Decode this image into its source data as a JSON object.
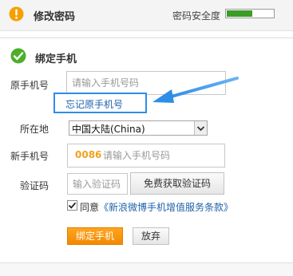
{
  "header": {
    "title": "修改密码",
    "security_label": "密码安全度",
    "security_level": 0.55,
    "security_color": "#3d9b28"
  },
  "section": {
    "title": "绑定手机"
  },
  "form": {
    "old_phone_label": "原手机号",
    "old_phone_placeholder": "请输入手机号码",
    "forgot_link": "忘记原手机号",
    "location_label": "所在地",
    "location_value": "中国大陆(China)",
    "new_phone_label": "新手机号",
    "country_code": "0086",
    "new_phone_placeholder": "请输入手机号码",
    "code_label": "验证码",
    "code_placeholder": "输入验证码",
    "get_code_button": "免费获取验证码",
    "agree_prefix": "同意",
    "agree_link": "《新浪微博手机增值服务条款》",
    "agree_checked": true,
    "bind_button": "绑定手机",
    "cancel_button": "放弃"
  },
  "colors": {
    "accent_orange": "#f28900",
    "link_blue": "#1e62a8",
    "highlight_blue": "#2d8de8"
  }
}
